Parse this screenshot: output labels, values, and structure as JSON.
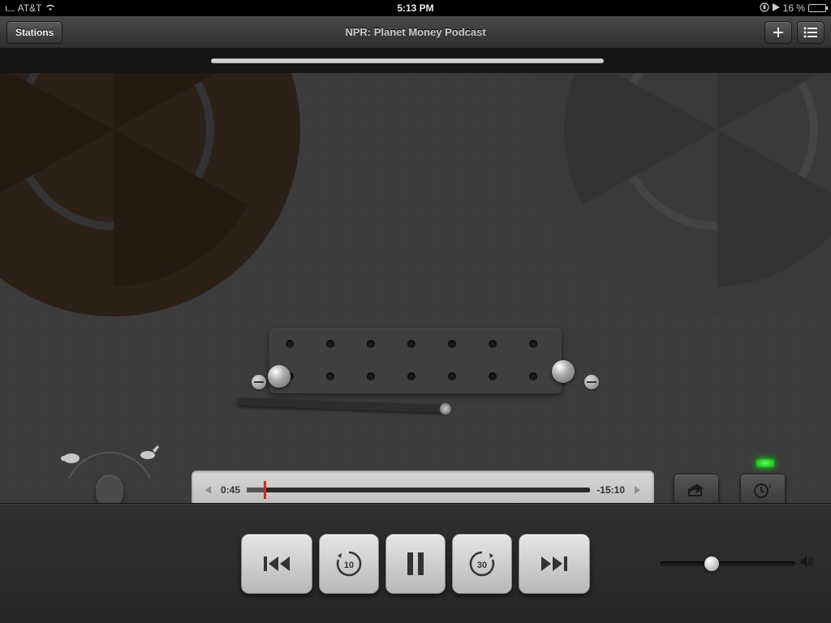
{
  "status": {
    "signal_glyph": "ı....",
    "carrier": "AT&T",
    "time": "5:13 PM",
    "battery_pct": "16 %"
  },
  "nav": {
    "back_label": "Stations",
    "title": "NPR: Planet Money Podcast"
  },
  "scrubber": {
    "elapsed": "0:45",
    "remaining": "-15:10"
  },
  "skip": {
    "back_seconds": "10",
    "forward_seconds": "30"
  }
}
